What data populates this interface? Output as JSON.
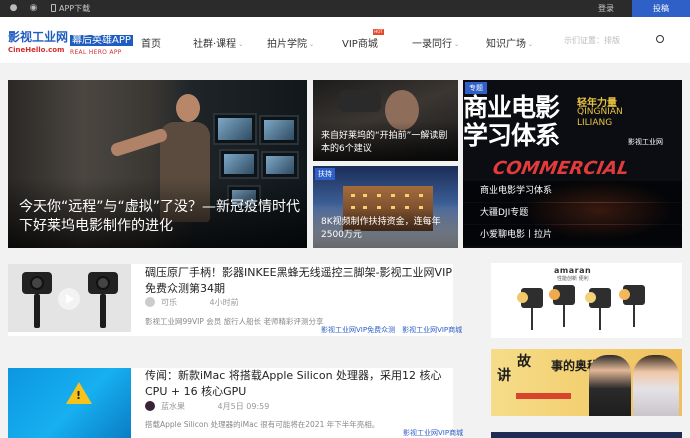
{
  "topbar": {
    "app_download": "APP下载",
    "login": "登录",
    "submit": "投稿"
  },
  "header": {
    "logo_cn": "影视工业网",
    "logo_en": "CineHello.com",
    "logo2_cn": "幕后英雄APP",
    "logo2_en": "REAL HERO APP",
    "nav": [
      {
        "label": "首页",
        "caret": false
      },
      {
        "label": "社群·课程",
        "caret": true
      },
      {
        "label": "拍片学院",
        "caret": true
      },
      {
        "label": "VIP商城",
        "caret": false,
        "badge": "HOT"
      },
      {
        "label": "一录同行",
        "caret": true
      },
      {
        "label": "知识广场",
        "caret": true
      }
    ],
    "search_placeholder": "示们证置：排版",
    "caret_glyph": "⌄"
  },
  "hero": {
    "big_caption": "今天你“远程”与“虚拟”了没？—新冠疫情时代下好莱坞电影制作的进化",
    "mid1_caption": "来自好莱坞的“开拍前”一解读剧本的6个建议",
    "mid2_tag": "扶持",
    "mid2_caption": "8K视频制作扶持资金，连每年2500万元",
    "right_tag": "专题",
    "right_title1": "商业电影",
    "right_title2": "学习体系",
    "right_qn1": "轻年力量",
    "right_qn2": "QINGNIAN LILIANG",
    "right_logo": "影视工业网",
    "right_commercial": "COMMERCIAL",
    "right_list": [
      "商业电影学习体系",
      "大疆DJI专题",
      "小爱聊电影丨拉片"
    ]
  },
  "articles": [
    {
      "title": "碉压原厂手柄！影器INKEE黑蜂无线遥控三脚架-影视工业网VIP免费众测第34期",
      "author": "可乐",
      "time": "4小时前",
      "desc": "影视工业网99VIP 会员 旅行人船长 老师精彩评测分享",
      "tags": [
        "影视工业网VIP免费众测",
        "影视工业网VIP商城"
      ]
    },
    {
      "title": "传闻：新款iMac 将搭载Apple Silicon 处理器，采用12 核心CPU + 16 核心GPU",
      "author": "蓝水果",
      "time": "4月5日 09:59",
      "desc": "搭载Apple Silicon 处理器的iMac 很有可能将在2021 年下半年亮相。",
      "tags": [
        "影视工业网VIP商城"
      ]
    }
  ],
  "ads": {
    "brand": "amaran",
    "brand_sub": "性能创新 便利",
    "story1": "讲",
    "story2": "故",
    "story3": "事的奥秘"
  },
  "colors": {
    "accent": "#2f60c7",
    "logo_red": "#d12e2e",
    "topbar_bg": "#2b2b2b"
  },
  "icons": {
    "wechat": "wechat-icon",
    "weibo": "weibo-icon",
    "phone": "phone-icon",
    "search": "search-icon",
    "play": "play-icon"
  }
}
